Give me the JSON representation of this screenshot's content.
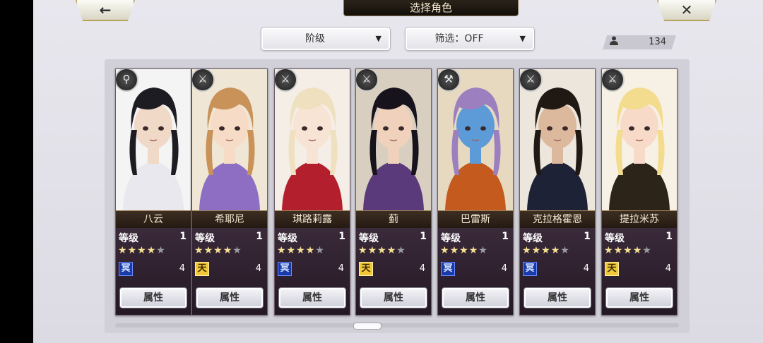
{
  "header": {
    "title": "选择角色",
    "back_icon": "←",
    "close_icon": "✕"
  },
  "filters": {
    "rank_label": "阶级",
    "filter_label": "筛选：OFF",
    "arrow": "▼"
  },
  "counter": {
    "icon": "person-icon",
    "value": "134"
  },
  "cards": [
    {
      "name": "八云",
      "level_label": "等级",
      "level": "1",
      "stars": 4,
      "element": "冥",
      "element_color": "blue",
      "count": "4",
      "attr_label": "属性",
      "class_icon": "⚲",
      "hair": "#1c1c22",
      "skin": "#f1d9c8",
      "outfit": "#e8e8ee",
      "bg": "#f4f4f4"
    },
    {
      "name": "希耶尼",
      "level_label": "等级",
      "level": "1",
      "stars": 4,
      "element": "天",
      "element_color": "gold",
      "count": "4",
      "attr_label": "属性",
      "class_icon": "⚔",
      "hair": "#c89258",
      "skin": "#f6dcc6",
      "outfit": "#8d6ec2",
      "bg": "#f0e6d6"
    },
    {
      "name": "琪路莉露",
      "level_label": "等级",
      "level": "1",
      "stars": 4,
      "element": "冥",
      "element_color": "blue",
      "count": "4",
      "attr_label": "属性",
      "class_icon": "⚔",
      "hair": "#efe1c0",
      "skin": "#f8e4d4",
      "outfit": "#b41f2e",
      "bg": "#f4eee6"
    },
    {
      "name": "蓟",
      "level_label": "等级",
      "level": "1",
      "stars": 4,
      "element": "天",
      "element_color": "gold",
      "count": "4",
      "attr_label": "属性",
      "class_icon": "⚔",
      "hair": "#17131c",
      "skin": "#f0d2bc",
      "outfit": "#5a3a7a",
      "bg": "#d9cfc0"
    },
    {
      "name": "巴雷斯",
      "level_label": "等级",
      "level": "1",
      "stars": 4,
      "element": "冥",
      "element_color": "blue",
      "count": "4",
      "attr_label": "属性",
      "class_icon": "⚒",
      "hair": "#9b7fbf",
      "skin": "#5c9bd8",
      "outfit": "#c45a1e",
      "bg": "#e7d8c0"
    },
    {
      "name": "克拉格霍恩",
      "level_label": "等级",
      "level": "1",
      "stars": 4,
      "element": "冥",
      "element_color": "blue",
      "count": "4",
      "attr_label": "属性",
      "class_icon": "⚔",
      "hair": "#201812",
      "skin": "#dcb89c",
      "outfit": "#1e2236",
      "bg": "#ece6dc"
    },
    {
      "name": "提拉米苏",
      "level_label": "等级",
      "level": "1",
      "stars": 4,
      "element": "天",
      "element_color": "gold",
      "count": "4",
      "attr_label": "属性",
      "class_icon": "⚔",
      "hair": "#f3dc8e",
      "skin": "#f7dac8",
      "outfit": "#2c2418",
      "bg": "#f7f0e4"
    }
  ]
}
